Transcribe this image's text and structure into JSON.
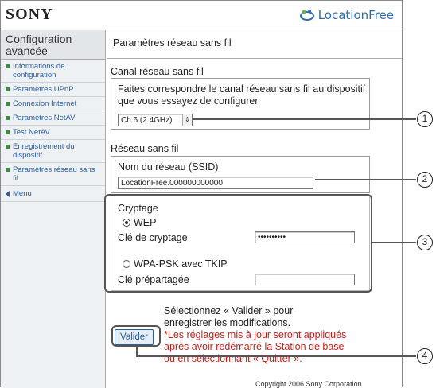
{
  "header": {
    "brand": "SONY",
    "product_logo_text": "LocationFree"
  },
  "sidebar": {
    "title": "Configuration avancée",
    "items": [
      {
        "label": "Informations de configuration"
      },
      {
        "label": "Paramètres UPnP"
      },
      {
        "label": "Connexion Internet"
      },
      {
        "label": "Paramètres NetAV"
      },
      {
        "label": "Test NetAV"
      },
      {
        "label": "Enregistrement du dispositif"
      },
      {
        "label": "Paramètres réseau sans fil"
      }
    ],
    "menu_label": "Menu"
  },
  "main": {
    "page_title": "Paramètres réseau sans fil",
    "channel": {
      "heading": "Canal réseau sans fil",
      "instruction": "Faites correspondre le canal réseau sans fil au dispositif que vous essayez de configurer.",
      "select_value": "Ch 6 (2.4GHz)"
    },
    "network": {
      "heading": "Réseau sans fil",
      "ssid_label": "Nom du réseau (SSID)",
      "ssid_value": "LocationFree.000000000000"
    },
    "encryption": {
      "heading": "Cryptage",
      "wep_label": "WEP",
      "wep_key_label": "Clé de cryptage",
      "wep_key_value": "••••••••••",
      "wpa_label": "WPA-PSK avec TKIP",
      "psk_label": "Clé prépartagée",
      "psk_value": ""
    },
    "footer": {
      "note": "Sélectionnez « Valider » pour enregistrer les modifications.",
      "warning": "*Les réglages mis à jour seront appliqués après avoir redémarré la Station de base ou en sélectionnant « Quitter ».",
      "validate_label": "Valider",
      "copyright": "Copyright 2006 Sony Corporation"
    }
  },
  "callouts": [
    "1",
    "2",
    "3",
    "4"
  ]
}
